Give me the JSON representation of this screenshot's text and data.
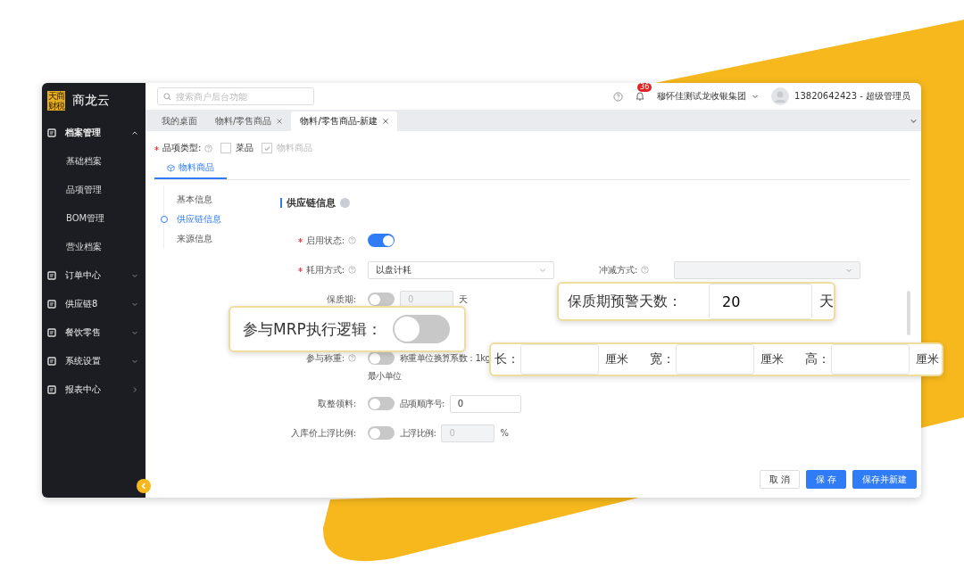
{
  "logo": {
    "lines": [
      "天商",
      "财税"
    ]
  },
  "app_name": "商龙云",
  "search": {
    "placeholder": "搜索商户后台功能"
  },
  "header": {
    "notifications": "36",
    "org": "穆怀佳测试龙收银集团",
    "user": "13820642423 - 超级管理员"
  },
  "sidebar": {
    "items": [
      {
        "label": "档案管理",
        "kind": "menu",
        "expanded": true,
        "children": [
          {
            "label": "基础档案"
          },
          {
            "label": "品项管理"
          },
          {
            "label": "BOM管理"
          },
          {
            "label": "营业档案"
          }
        ]
      },
      {
        "label": "订单中心",
        "kind": "menu",
        "expanded": false
      },
      {
        "label": "供应链8",
        "kind": "menu",
        "expanded": false
      },
      {
        "label": "餐饮零售",
        "kind": "menu",
        "expanded": false
      },
      {
        "label": "系统设置",
        "kind": "menu",
        "expanded": false
      },
      {
        "label": "报表中心",
        "kind": "link",
        "expanded": false
      }
    ]
  },
  "tabs": [
    {
      "label": "我的桌面",
      "closable": false,
      "selected": false
    },
    {
      "label": "物料/零售商品",
      "closable": true,
      "selected": false
    },
    {
      "label": "物料/零售商品-新建",
      "closable": true,
      "selected": true
    }
  ],
  "item_type": {
    "label": "品项类型:",
    "required": true,
    "options": [
      {
        "label": "菜品",
        "checked": false,
        "disabled": false
      },
      {
        "label": "物料商品",
        "checked": true,
        "disabled": true
      }
    ]
  },
  "sub_tabs": [
    {
      "label": "物料商品",
      "selected": true
    }
  ],
  "steps": [
    {
      "label": "基本信息",
      "selected": false
    },
    {
      "label": "供应链信息",
      "selected": true
    },
    {
      "label": "来源信息",
      "selected": false
    }
  ],
  "section_title": "供应链信息",
  "rows": [
    {
      "label": "启用状态:",
      "required": true,
      "help": true,
      "controls": [
        {
          "kind": "toggle",
          "on": true
        }
      ]
    },
    {
      "label": "耗用方式:",
      "required": true,
      "help": true,
      "controls": [
        {
          "kind": "select",
          "value": "以盘计耗",
          "disabled": false
        },
        {
          "kind": "label",
          "text": "冲减方式:",
          "help": true
        },
        {
          "kind": "select",
          "disabled": true
        }
      ]
    },
    {
      "label": "保质期:",
      "required": false,
      "help": false,
      "controls": [
        {
          "kind": "toggle",
          "on": false
        },
        {
          "kind": "input",
          "value": "0",
          "disabled": true
        },
        {
          "kind": "text",
          "text": "天"
        }
      ]
    },
    {
      "label": "参与称重:",
      "required": false,
      "help": true,
      "controls": [
        {
          "kind": "toggle",
          "on": false
        },
        {
          "kind": "text",
          "text": "称重单位换算系数：1kg"
        }
      ]
    },
    {
      "controls": [
        {
          "kind": "text",
          "text": "最小单位"
        }
      ]
    },
    {
      "label": "取整领料:",
      "required": false,
      "help": false,
      "controls": [
        {
          "kind": "toggle",
          "on": false
        },
        {
          "kind": "text",
          "text": "品项顺序号:"
        },
        {
          "kind": "input",
          "value": "0",
          "disabled": false
        }
      ]
    },
    {
      "label": "入库价上浮比例:",
      "required": false,
      "help": false,
      "controls": [
        {
          "kind": "toggle",
          "on": false
        },
        {
          "kind": "text",
          "text": "上浮比例:"
        },
        {
          "kind": "input",
          "value": "0",
          "disabled": true
        },
        {
          "kind": "text",
          "text": "%"
        }
      ]
    }
  ],
  "buttons": [
    {
      "label": "取 消",
      "kind": "default"
    },
    {
      "label": "保 存",
      "kind": "primary"
    },
    {
      "label": "保存并新建",
      "kind": "primary"
    }
  ],
  "callouts": {
    "mrp": {
      "label": "参与MRP执行逻辑：",
      "on": false
    },
    "warning": {
      "label": "保质期预警天数：",
      "value": "20",
      "unit": "天"
    },
    "dims": [
      {
        "label": "长：",
        "unit": "厘米"
      },
      {
        "label": "宽：",
        "unit": "厘米"
      },
      {
        "label": "高：",
        "unit": "厘米"
      }
    ]
  }
}
